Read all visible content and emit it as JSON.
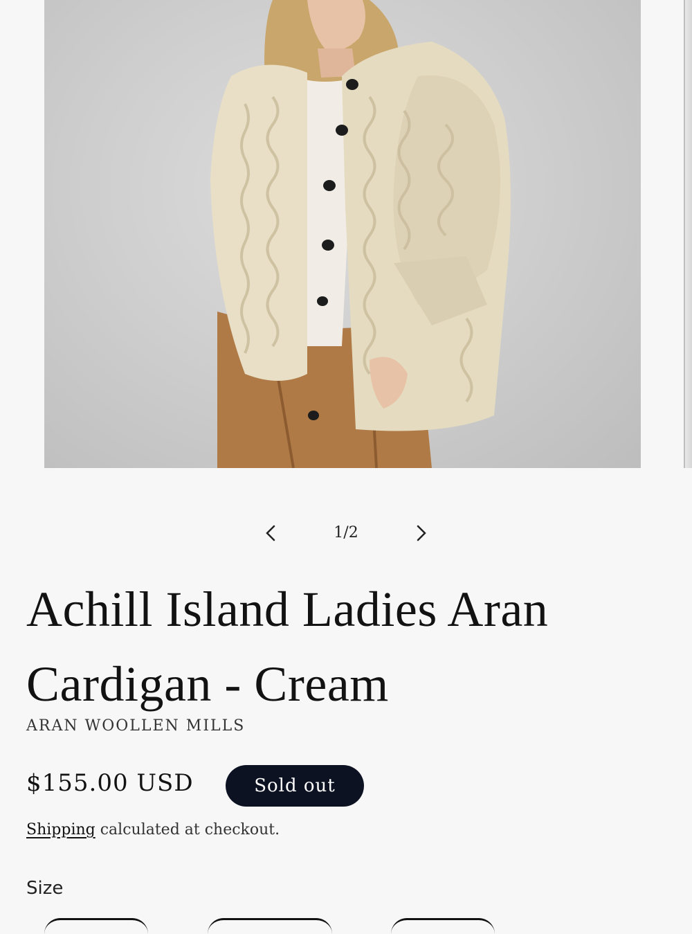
{
  "gallery": {
    "image_alt": "Achill Island Ladies Aran Cardigan - Cream",
    "counter": "1/2",
    "prev_icon": "chevron-left-icon",
    "next_icon": "chevron-right-icon"
  },
  "product": {
    "title": "Achill Island Ladies Aran Cardigan - Cream",
    "vendor": "ARAN WOOLLEN MILLS",
    "price": "$155.00 USD",
    "badge": "Sold out",
    "shipping_link": "Shipping",
    "shipping_text": " calculated at checkout.",
    "size_label": "Size"
  },
  "colors": {
    "badge_bg": "#0d1223",
    "text": "#121212",
    "sweater": "#e8dfc6",
    "trousers": "#b07a46"
  }
}
